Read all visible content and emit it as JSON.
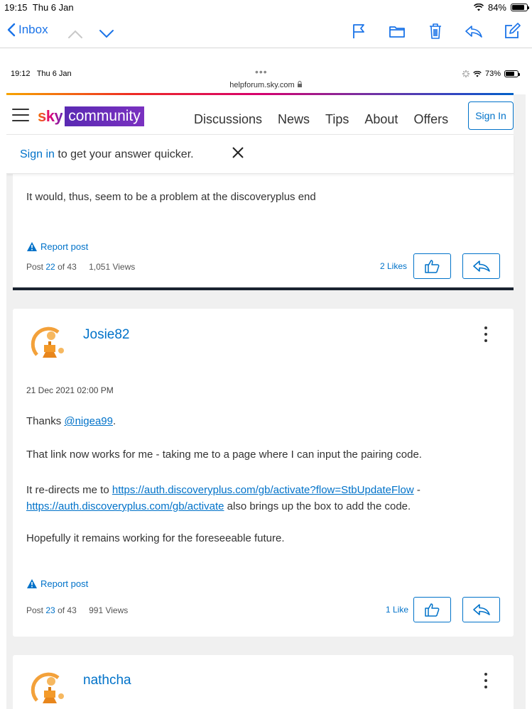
{
  "os_status": {
    "time": "19:15",
    "date": "Thu 6 Jan",
    "battery": "84%",
    "battery_level": 0.84
  },
  "mail_toolbar": {
    "back_label": "Inbox"
  },
  "inner_status": {
    "time": "19:12",
    "date": "Thu 6 Jan",
    "url": "helpforum.sky.com",
    "battery": "73%",
    "battery_level": 0.73
  },
  "site_nav": {
    "logo_sky": "sky",
    "logo_community": "community",
    "links": [
      "Discussions",
      "News",
      "Tips",
      "About",
      "Offers"
    ],
    "sign_in_button": "Sign In"
  },
  "banner": {
    "link_text": "Sign in",
    "text": " to get your answer quicker."
  },
  "posts": [
    {
      "body": "It would, thus,  seem to be a problem  at the discoveryplus end",
      "report_label": "Report post",
      "post_prefix": "Post",
      "post_number": "22",
      "post_total_text": "of 43",
      "views": "1,051 Views",
      "likes": "2 Likes"
    },
    {
      "username": "Josie82",
      "date": "21 Dec 2021 02:00 PM",
      "thanks_prefix": "Thanks ",
      "mention": "@nigea99",
      "thanks_suffix": ".",
      "para2": "That link now works for me - taking me to a page where I can input the pairing code.",
      "para3_prefix": "It re-directs me to ",
      "link1": "https://auth.discoveryplus.com/gb/activate?flow=StbUpdateFlow",
      "para3_mid": " -",
      "link2": "https://auth.discoveryplus.com/gb/activate",
      "para3_suffix": " also brings up the box to add the code.",
      "para4": "Hopefully it remains working for the foreseeable future.",
      "report_label": "Report post",
      "post_prefix": "Post",
      "post_number": "23",
      "post_total_text": "of 43",
      "views": "991 Views",
      "likes": "1 Like"
    },
    {
      "username": "nathcha"
    }
  ],
  "icons": [
    "chevron-left-icon",
    "chevron-up-icon",
    "chevron-down-icon",
    "flag-icon",
    "folder-icon",
    "trash-icon",
    "reply-icon",
    "compose-icon",
    "wifi-icon",
    "lock-icon",
    "hamburger-icon",
    "close-icon",
    "warning-icon",
    "thumbs-up-icon",
    "reply-arrow-icon",
    "kebab-icon",
    "avatar-icon"
  ]
}
